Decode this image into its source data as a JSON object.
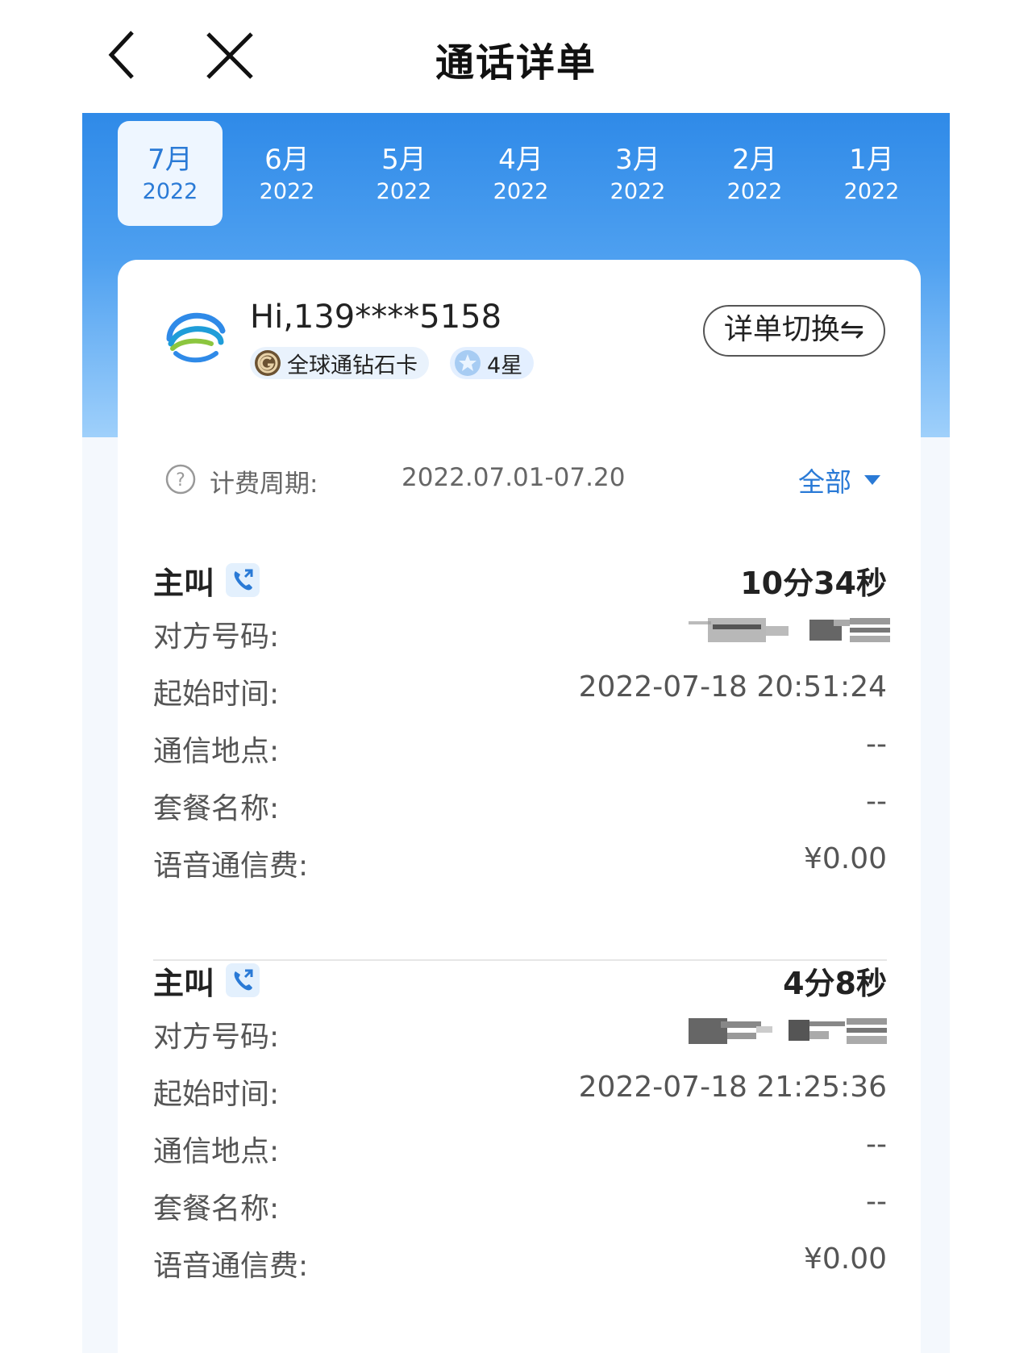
{
  "header": {
    "title": "通话详单",
    "back_icon": "chevron-left-icon",
    "close_icon": "close-icon"
  },
  "month_tabs": [
    {
      "month": "7月",
      "year": "2022",
      "active": true
    },
    {
      "month": "6月",
      "year": "2022",
      "active": false
    },
    {
      "month": "5月",
      "year": "2022",
      "active": false
    },
    {
      "month": "4月",
      "year": "2022",
      "active": false
    },
    {
      "month": "3月",
      "year": "2022",
      "active": false
    },
    {
      "month": "2月",
      "year": "2022",
      "active": false
    },
    {
      "month": "1月",
      "year": "2022",
      "active": false
    }
  ],
  "user": {
    "greeting": "Hi,139****5158",
    "card_level": "全球通钻石卡",
    "star_level": "4星"
  },
  "switch_button": "详单切换⇋",
  "billing": {
    "label": "计费周期:",
    "period": "2022.07.01-07.20"
  },
  "filter": {
    "selected": "全部"
  },
  "records": [
    {
      "type": "主叫",
      "duration": "10分34秒",
      "rows": {
        "peer_label": "对方号码:",
        "start_label": "起始时间:",
        "start_value": "2022-07-18 20:51:24",
        "location_label": "通信地点:",
        "location_value": "--",
        "package_label": "套餐名称:",
        "package_value": "--",
        "fee_label": "语音通信费:",
        "fee_value": "¥0.00"
      }
    },
    {
      "type": "主叫",
      "duration": "4分8秒",
      "rows": {
        "peer_label": "对方号码:",
        "start_label": "起始时间:",
        "start_value": "2022-07-18 21:25:36",
        "location_label": "通信地点:",
        "location_value": "--",
        "package_label": "套餐名称:",
        "package_value": "--",
        "fee_label": "语音通信费:",
        "fee_value": "¥0.00"
      }
    }
  ],
  "colors": {
    "accent": "#2a7ad6",
    "band_top": "#2f8ae8",
    "band_bottom": "#9fd0fb"
  }
}
